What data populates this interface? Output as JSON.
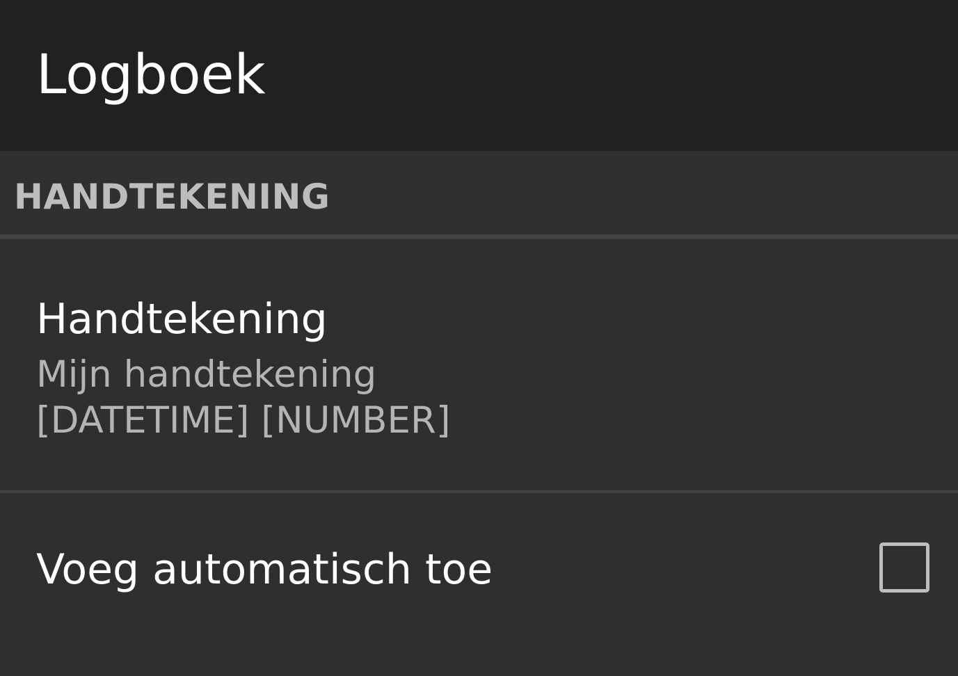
{
  "app_bar": {
    "title": "Logboek"
  },
  "section": {
    "title": "HANDTEKENING"
  },
  "preferences": {
    "signature": {
      "title": "Handtekening",
      "summary_line1": "Mijn handtekening",
      "summary_line2": "[DATETIME] [NUMBER]"
    },
    "auto_add": {
      "title": "Voeg automatisch toe",
      "checked": false
    }
  },
  "colors": {
    "app_bar_bg": "#212121",
    "content_bg": "#2f2f2f",
    "primary_text": "#ffffff",
    "secondary_text": "#b4b4b4",
    "header_text": "#bdbdbd"
  },
  "icons": {
    "checkbox": "checkbox-unchecked-icon"
  }
}
